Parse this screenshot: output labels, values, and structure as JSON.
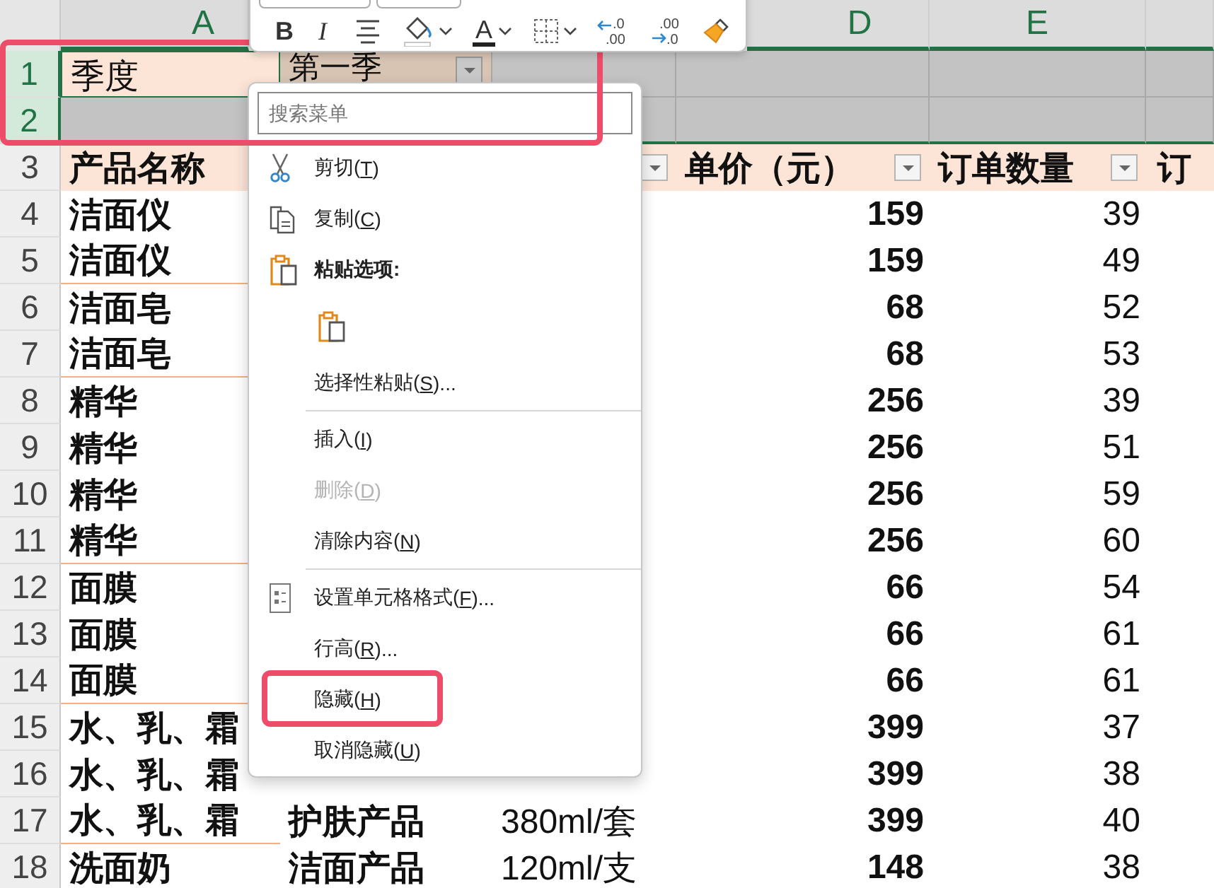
{
  "mini_toolbar": {
    "buttons": [
      {
        "kind": "bold",
        "text": "B",
        "dropdown": false
      },
      {
        "kind": "italic",
        "text": "I",
        "dropdown": false
      },
      {
        "kind": "align",
        "dropdown": false
      },
      {
        "kind": "fill",
        "dropdown": true
      },
      {
        "kind": "font-color",
        "text": "A",
        "dropdown": true
      },
      {
        "kind": "borders",
        "dropdown": true
      },
      {
        "kind": "increase-decimal",
        "lines": [
          ".0",
          ".00"
        ],
        "dropdown": false
      },
      {
        "kind": "decrease-decimal",
        "lines": [
          ".00",
          ".0"
        ],
        "dropdown": false
      },
      {
        "kind": "format-painter",
        "dropdown": false
      }
    ]
  },
  "sheet": {
    "column_headers": [
      "A",
      "D",
      "E"
    ],
    "rows": [
      {
        "number": "1",
        "selected": true,
        "highlighted": true,
        "group_end": false,
        "cells": [
          {
            "kind": "label",
            "text": "季度",
            "active": true,
            "filter": false
          },
          {
            "kind": "label",
            "text": "第一季",
            "active": false,
            "filter": true
          }
        ]
      },
      {
        "number": "2",
        "selected": true,
        "highlighted": true,
        "group_end": false
      },
      {
        "number": "3",
        "selected": false,
        "highlighted": false,
        "group_end": false,
        "cells": [
          {
            "kind": "header",
            "text": "产品名称"
          },
          {
            "kind": "header"
          },
          {
            "kind": "header",
            "filter": true
          },
          {
            "kind": "header",
            "text": "单价（元）",
            "filter": true
          },
          {
            "kind": "header",
            "text": "订单数量",
            "filter": true
          },
          {
            "kind": "header",
            "text": "订"
          }
        ]
      },
      {
        "number": "4",
        "selected": false,
        "highlighted": false,
        "group_end": false,
        "cells": [
          {
            "kind": "bold",
            "text": "洁面仪"
          },
          {
            "kind": "empty"
          },
          {
            "kind": "empty"
          },
          {
            "kind": "number-bold",
            "text": "159"
          },
          {
            "kind": "number",
            "text": "39"
          }
        ]
      },
      {
        "number": "5",
        "selected": false,
        "highlighted": false,
        "group_end": true,
        "cells": [
          {
            "kind": "bold",
            "text": "洁面仪"
          },
          {
            "kind": "empty"
          },
          {
            "kind": "empty"
          },
          {
            "kind": "number-bold",
            "text": "159"
          },
          {
            "kind": "number",
            "text": "49"
          }
        ]
      },
      {
        "number": "6",
        "selected": false,
        "highlighted": false,
        "group_end": false,
        "cells": [
          {
            "kind": "bold",
            "text": "洁面皂"
          },
          {
            "kind": "empty"
          },
          {
            "kind": "empty"
          },
          {
            "kind": "number-bold",
            "text": "68"
          },
          {
            "kind": "number",
            "text": "52"
          }
        ]
      },
      {
        "number": "7",
        "selected": false,
        "highlighted": false,
        "group_end": true,
        "cells": [
          {
            "kind": "bold",
            "text": "洁面皂"
          },
          {
            "kind": "empty"
          },
          {
            "kind": "empty"
          },
          {
            "kind": "number-bold",
            "text": "68"
          },
          {
            "kind": "number",
            "text": "53"
          }
        ]
      },
      {
        "number": "8",
        "selected": false,
        "highlighted": false,
        "group_end": false,
        "cells": [
          {
            "kind": "bold",
            "text": "精华"
          },
          {
            "kind": "empty"
          },
          {
            "kind": "empty"
          },
          {
            "kind": "number-bold",
            "text": "256"
          },
          {
            "kind": "number",
            "text": "39"
          }
        ]
      },
      {
        "number": "9",
        "selected": false,
        "highlighted": false,
        "group_end": false,
        "cells": [
          {
            "kind": "bold",
            "text": "精华"
          },
          {
            "kind": "empty"
          },
          {
            "kind": "empty"
          },
          {
            "kind": "number-bold",
            "text": "256"
          },
          {
            "kind": "number",
            "text": "51"
          }
        ]
      },
      {
        "number": "10",
        "selected": false,
        "highlighted": false,
        "group_end": false,
        "cells": [
          {
            "kind": "bold",
            "text": "精华"
          },
          {
            "kind": "empty"
          },
          {
            "kind": "empty"
          },
          {
            "kind": "number-bold",
            "text": "256"
          },
          {
            "kind": "number",
            "text": "59"
          }
        ]
      },
      {
        "number": "11",
        "selected": false,
        "highlighted": false,
        "group_end": true,
        "cells": [
          {
            "kind": "bold",
            "text": "精华"
          },
          {
            "kind": "empty"
          },
          {
            "kind": "empty"
          },
          {
            "kind": "number-bold",
            "text": "256"
          },
          {
            "kind": "number",
            "text": "60"
          }
        ]
      },
      {
        "number": "12",
        "selected": false,
        "highlighted": false,
        "group_end": false,
        "cells": [
          {
            "kind": "bold",
            "text": "面膜"
          },
          {
            "kind": "empty"
          },
          {
            "kind": "empty"
          },
          {
            "kind": "number-bold",
            "text": "66"
          },
          {
            "kind": "number",
            "text": "54"
          }
        ]
      },
      {
        "number": "13",
        "selected": false,
        "highlighted": false,
        "group_end": false,
        "cells": [
          {
            "kind": "bold",
            "text": "面膜"
          },
          {
            "kind": "empty"
          },
          {
            "kind": "empty"
          },
          {
            "kind": "number-bold",
            "text": "66"
          },
          {
            "kind": "number",
            "text": "61"
          }
        ]
      },
      {
        "number": "14",
        "selected": false,
        "highlighted": false,
        "group_end": true,
        "cells": [
          {
            "kind": "bold",
            "text": "面膜"
          },
          {
            "kind": "empty"
          },
          {
            "kind": "empty"
          },
          {
            "kind": "number-bold",
            "text": "66"
          },
          {
            "kind": "number",
            "text": "61"
          }
        ]
      },
      {
        "number": "15",
        "selected": false,
        "highlighted": false,
        "group_end": false,
        "cells": [
          {
            "kind": "bold",
            "text": "水、乳、霜"
          },
          {
            "kind": "empty"
          },
          {
            "kind": "empty"
          },
          {
            "kind": "number-bold",
            "text": "399"
          },
          {
            "kind": "number",
            "text": "37"
          }
        ]
      },
      {
        "number": "16",
        "selected": false,
        "highlighted": false,
        "group_end": false,
        "cells": [
          {
            "kind": "bold",
            "text": "水、乳、霜"
          },
          {
            "kind": "empty"
          },
          {
            "kind": "empty"
          },
          {
            "kind": "number-bold",
            "text": "399"
          },
          {
            "kind": "number",
            "text": "38"
          }
        ]
      },
      {
        "number": "17",
        "selected": false,
        "highlighted": false,
        "group_end": true,
        "cells": [
          {
            "kind": "bold",
            "text": "水、乳、霜"
          },
          {
            "kind": "bold",
            "text": "护肤产品"
          },
          {
            "kind": "plain",
            "text": "380ml/套"
          },
          {
            "kind": "number-bold",
            "text": "399"
          },
          {
            "kind": "number",
            "text": "40"
          }
        ]
      },
      {
        "number": "18",
        "selected": false,
        "highlighted": false,
        "group_end": false,
        "cells": [
          {
            "kind": "bold",
            "text": "洗面奶"
          },
          {
            "kind": "bold",
            "text": "洁面产品"
          },
          {
            "kind": "plain",
            "text": "120ml/支"
          },
          {
            "kind": "number-bold",
            "text": "148"
          },
          {
            "kind": "number",
            "text": "38"
          }
        ]
      }
    ]
  },
  "context_menu": {
    "search": {
      "placeholder": "搜索菜单"
    },
    "items": [
      {
        "kind": "cut",
        "label": "剪切(",
        "key": "T",
        "after": ")",
        "disabled": false,
        "highlighted": false
      },
      {
        "kind": "copy",
        "label": "复制(",
        "key": "C",
        "after": ")",
        "disabled": false,
        "highlighted": false
      },
      {
        "kind": "paste-heading",
        "label": "粘贴选项:"
      },
      {
        "kind": "paste-options",
        "buttons": [
          {
            "kind": "paste"
          }
        ]
      },
      {
        "kind": "command",
        "label": "选择性粘贴(",
        "key": "S",
        "after": ")...",
        "disabled": false,
        "highlighted": false
      },
      {
        "kind": "separator"
      },
      {
        "kind": "command",
        "label": "插入(",
        "key": "I",
        "after": ")",
        "disabled": false,
        "highlighted": false
      },
      {
        "kind": "command",
        "label": "删除(",
        "key": "D",
        "after": ")",
        "disabled": true,
        "highlighted": false
      },
      {
        "kind": "command",
        "label": "清除内容(",
        "key": "N",
        "after": ")",
        "disabled": false,
        "highlighted": false
      },
      {
        "kind": "separator"
      },
      {
        "kind": "format-cells",
        "label": "设置单元格格式(",
        "key": "F",
        "after": ")...",
        "disabled": false,
        "highlighted": false
      },
      {
        "kind": "command",
        "label": "行高(",
        "key": "R",
        "after": ")...",
        "disabled": false,
        "highlighted": false
      },
      {
        "kind": "command",
        "label": "隐藏(",
        "key": "H",
        "after": ")",
        "disabled": false,
        "highlighted": true
      },
      {
        "kind": "command",
        "label": "取消隐藏(",
        "key": "U",
        "after": ")",
        "disabled": false,
        "highlighted": false
      }
    ]
  }
}
